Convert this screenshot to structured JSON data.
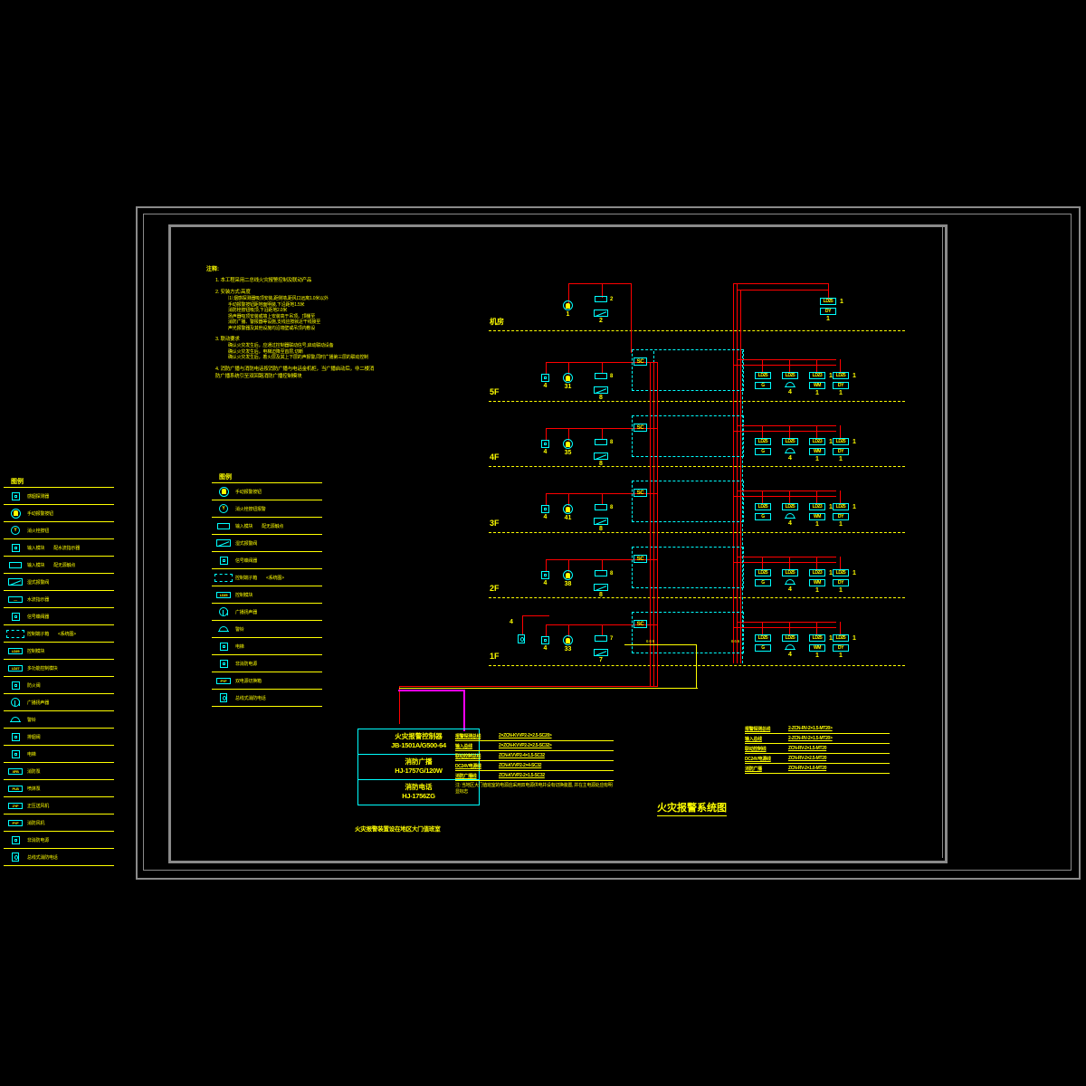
{
  "sheet": {
    "title": "火灾报警系统图",
    "caption_equipment": "火灾报警装置设在地区大门值班室"
  },
  "notes": {
    "title": "注释:",
    "items": [
      "1. 本工程采用二总线火灾报警控制及联动产品",
      "2. 安装方式:高度",
      "3. 联动要求",
      "4. 消防广播与消防电话按消防广播与电话金机柜，当广播启动后，非二楼消防广播系统引至双回路消防广播控制模块"
    ],
    "sub2": [
      "⑴ 烟感探测器吸顶安装,距侧墙,距风口远离1.0米以外",
      "手动报警按钮距地面明装,下沿距地1.5米",
      "消防栓按钮吸顶,下沿距地2.0米",
      "扬声器吸顶安装或墙上安装高于吊顶，顶棚至",
      "消防广播、警报器等设施,支线应按就近干线接至",
      "声光报警器及其他设施均沿墙壁或吊顶内敷设"
    ],
    "sub3": [
      "确认火灾发生后，应通过控制器联动信号,启动联动设备",
      "确认火灾发生后，电梯迫降至首层,切断",
      "确认火灾发生后，着火层及其上下层的声报警,同时广播第三层的联动控制"
    ]
  },
  "legend_left": {
    "title": "图例",
    "rows": [
      {
        "icon": "smoke-detector-icon",
        "label": "感烟探测器",
        "label2": ""
      },
      {
        "icon": "manual-call-point-icon",
        "label": "手动报警按钮",
        "label2": ""
      },
      {
        "icon": "hydrant-button-icon",
        "label": "消火栓按钮",
        "label2": ""
      },
      {
        "icon": "input-module-icon",
        "label": "输入模块",
        "label2": "配水流指示器"
      },
      {
        "icon": "input-module-plain-icon",
        "label": "输入模块",
        "label2": "配无源触点"
      },
      {
        "icon": "water-flow-icon",
        "label": "湿式报警阀",
        "label2": ""
      },
      {
        "icon": "flow-indicator-icon",
        "label": "水流指示器",
        "label2": ""
      },
      {
        "icon": "signal-valve-icon",
        "label": "信号蝶阀器",
        "label2": ""
      },
      {
        "icon": "dashed-box-icon",
        "label": "控制端子箱",
        "label2": "<系统图>"
      },
      {
        "icon": "control-module-icon",
        "label": "控制模块",
        "label2": ""
      },
      {
        "icon": "multi-control-icon",
        "label": "多功能控制模块",
        "label2": ""
      },
      {
        "icon": "fire-damper-icon",
        "label": "防火阀",
        "label2": ""
      },
      {
        "icon": "speaker-icon",
        "label": "广播扬声器",
        "label2": ""
      },
      {
        "icon": "bell-icon",
        "label": "警铃",
        "label2": ""
      },
      {
        "icon": "smoke-damper-icon",
        "label": "排烟阀",
        "label2": ""
      },
      {
        "icon": "elevator-icon",
        "label": "电梯",
        "label2": ""
      },
      {
        "icon": "sprinkler-pump-icon",
        "label": "消防泵",
        "label2": ""
      },
      {
        "icon": "spray-pump-icon",
        "label": "喷淋泵",
        "label2": ""
      },
      {
        "icon": "pressure-fan-icon",
        "label": "正压送风机",
        "label2": ""
      },
      {
        "icon": "exhaust-fan-icon",
        "label": "消防风机",
        "label2": ""
      },
      {
        "icon": "backup-power-icon",
        "label": "非消防电源",
        "label2": ""
      },
      {
        "icon": "fire-phone-icon",
        "label": "总线式消防电话",
        "label2": ""
      }
    ]
  },
  "legend_mid": {
    "title": "图例",
    "rows": [
      {
        "icon": "manual-call-point-icon",
        "label": "手动报警按钮",
        "label2": ""
      },
      {
        "icon": "hydrant-button-icon",
        "label": "消火栓按钮报警",
        "label2": ""
      },
      {
        "icon": "input-module-plain-icon",
        "label": "输入模块",
        "label2": "配无源触点"
      },
      {
        "icon": "water-flow-icon",
        "label": "湿式报警阀",
        "label2": ""
      },
      {
        "icon": "signal-valve-icon",
        "label": "信号蝶阀器",
        "label2": ""
      },
      {
        "icon": "dashed-box-icon",
        "label": "控制端子箱",
        "label2": "<系统图>"
      },
      {
        "icon": "control-module-icon",
        "label": "控制模块",
        "label2": ""
      },
      {
        "icon": "speaker-icon",
        "label": "广播扬声器",
        "label2": ""
      },
      {
        "icon": "bell-icon",
        "label": "警铃",
        "label2": ""
      },
      {
        "icon": "elevator-icon",
        "label": "电梯",
        "label2": ""
      },
      {
        "icon": "backup-power-icon",
        "label": "非消防电源",
        "label2": ""
      },
      {
        "icon": "exhaust-fan-icon",
        "label": "双电源切换箱",
        "label2": ""
      },
      {
        "icon": "fire-phone-icon",
        "label": "总线式消防电话",
        "label2": ""
      }
    ]
  },
  "diagram": {
    "floors": [
      {
        "label": "机房",
        "left_devices": [],
        "note": ""
      },
      {
        "label": "5F",
        "left_devices": [],
        "note": ""
      },
      {
        "label": "4F",
        "left_devices": [],
        "note": ""
      },
      {
        "label": "3F",
        "left_devices": [],
        "note": ""
      },
      {
        "label": "2F",
        "left_devices": [],
        "note": ""
      },
      {
        "label": "1F",
        "left_devices": [],
        "note": ""
      }
    ],
    "roof_row": {
      "manual_qty": "1",
      "module_qty": "2",
      "valve_qty": "2",
      "right_tag": "LD25",
      "right_dev": "DY",
      "right_count": "1",
      "right_qty": "1"
    },
    "typical_rows": [
      {
        "floor": "5F",
        "input_qty": "4",
        "smoke_qty": "31",
        "valve_qty": "8",
        "module_qty": "8",
        "modules": [
          {
            "tag": "LD25",
            "dev": "G",
            "qty": ""
          },
          {
            "tag": "LD25",
            "dev": "BELL",
            "qty": "4"
          },
          {
            "tag": "LD23",
            "dev": "WM",
            "qty": "1",
            "count": "1"
          },
          {
            "tag": "LD25",
            "dev": "DY",
            "qty": "1",
            "count": "1"
          }
        ]
      },
      {
        "floor": "4F",
        "input_qty": "4",
        "smoke_qty": "35",
        "valve_qty": "8",
        "module_qty": "8",
        "modules": [
          {
            "tag": "LD25",
            "dev": "G",
            "qty": ""
          },
          {
            "tag": "LD25",
            "dev": "BELL",
            "qty": "4"
          },
          {
            "tag": "LD23",
            "dev": "WM",
            "qty": "1",
            "count": "1"
          },
          {
            "tag": "LD25",
            "dev": "DY",
            "qty": "1",
            "count": "1"
          }
        ]
      },
      {
        "floor": "3F",
        "input_qty": "4",
        "smoke_qty": "41",
        "valve_qty": "8",
        "module_qty": "8",
        "modules": [
          {
            "tag": "LD25",
            "dev": "G",
            "qty": ""
          },
          {
            "tag": "LD25",
            "dev": "BELL",
            "qty": "4"
          },
          {
            "tag": "LD23",
            "dev": "WM",
            "qty": "1",
            "count": "1"
          },
          {
            "tag": "LD25",
            "dev": "DY",
            "qty": "1",
            "count": "1"
          }
        ]
      },
      {
        "floor": "2F",
        "input_qty": "4",
        "smoke_qty": "38",
        "valve_qty": "8",
        "module_qty": "8",
        "modules": [
          {
            "tag": "LD25",
            "dev": "G",
            "qty": ""
          },
          {
            "tag": "LD25",
            "dev": "BELL",
            "qty": "4"
          },
          {
            "tag": "LD23",
            "dev": "WM",
            "qty": "1",
            "count": "1"
          },
          {
            "tag": "LD25",
            "dev": "DY",
            "qty": "1",
            "count": "1"
          }
        ]
      },
      {
        "floor": "1F",
        "input_qty": "4",
        "smoke_qty": "33",
        "valve_qty": "7",
        "module_qty": "7",
        "phone_qty": "4",
        "modules": [
          {
            "tag": "LD25",
            "dev": "G",
            "qty": ""
          },
          {
            "tag": "LD25",
            "dev": "BELL",
            "qty": "4"
          },
          {
            "tag": "LD25",
            "dev": "WM",
            "qty": "1",
            "count": "1"
          },
          {
            "tag": "LD25",
            "dev": "DY",
            "qty": "1",
            "count": "1"
          }
        ]
      }
    ],
    "sc_label": "SC",
    "riser_marks": "6 6 6"
  },
  "equipment": [
    {
      "name": "火灾报警控制器",
      "model": "JB-1501A/G500-64"
    },
    {
      "name": "消防广播",
      "model": "HJ-1757G/120W"
    },
    {
      "name": "消防电话",
      "model": "HJ-1756ZG"
    }
  ],
  "cable_table_left": {
    "rows": [
      {
        "k": "报警探测总线",
        "v": "2×ZCN-KVVP2-2×2.5-SC20>"
      },
      {
        "k": "输入总线",
        "v": "2×ZCN-KVVP2-2×2.5-SC32>"
      },
      {
        "k": "联动控制总线",
        "v": "ZCN-KVVP2-4×1.5-SC32"
      },
      {
        "k": "DC24V电源线",
        "v": "ZCN-KVVP2-2×4-SC32"
      },
      {
        "k": "消防广播线",
        "v": "ZCN-KVVP2-2×1.5-SC32"
      }
    ],
    "note": "注: 当地区大门值班室的电源应采用双电源供电并设有切换装置, 并在主电源处应有明显标志"
  },
  "cable_table_right": {
    "rows": [
      {
        "k": "报警探测总线",
        "v": "2-ZCN-RV-2×1.5-MT20>"
      },
      {
        "k": "输入总线",
        "v": "2-ZCN-RV-2×1.5-MT20>"
      },
      {
        "k": "联动控制线",
        "v": "ZCN-RV-2×1.5-MT20"
      },
      {
        "k": "DC24V电源线",
        "v": "ZCN-RV-2×2.5-MT20"
      },
      {
        "k": "消防广播",
        "v": "ZCN-RV-2×1.0-MT20"
      }
    ]
  }
}
